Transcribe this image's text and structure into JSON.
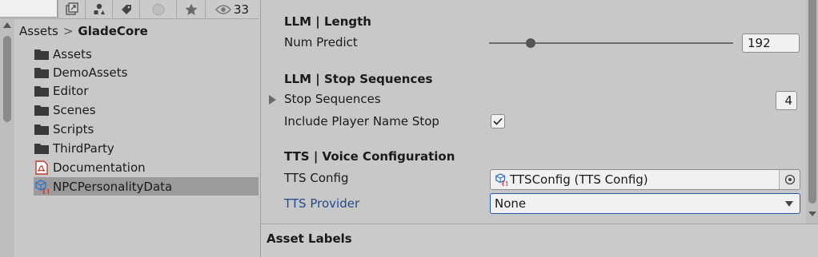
{
  "project": {
    "toolbar": {
      "hidden_count": "33"
    },
    "breadcrumb": {
      "root": "Assets",
      "separator": ">",
      "current": "GladeCore"
    },
    "items": [
      {
        "label": "Assets",
        "icon": "folder-icon"
      },
      {
        "label": "DemoAssets",
        "icon": "folder-icon"
      },
      {
        "label": "Editor",
        "icon": "folder-icon"
      },
      {
        "label": "Scenes",
        "icon": "folder-icon"
      },
      {
        "label": "Scripts",
        "icon": "folder-icon"
      },
      {
        "label": "ThirdParty",
        "icon": "folder-icon"
      },
      {
        "label": "Documentation",
        "icon": "pdf-icon"
      },
      {
        "label": "NPCPersonalityData",
        "icon": "scriptable-object-icon"
      }
    ]
  },
  "inspector": {
    "length_header": "LLM | Length",
    "num_predict_label": "Num Predict",
    "num_predict_value": "192",
    "num_predict_slider_fraction": 0.17,
    "stop_header": "LLM | Stop Sequences",
    "stop_sequences_label": "Stop Sequences",
    "stop_sequences_count": "4",
    "include_player_name_stop_label": "Include Player Name Stop",
    "include_player_name_stop_checked": true,
    "tts_header": "TTS | Voice Configuration",
    "tts_config_label": "TTS Config",
    "tts_config_value": "TTSConfig (TTS Config)",
    "tts_provider_label": "TTS Provider",
    "tts_provider_value": "None",
    "asset_labels_title": "Asset Labels"
  },
  "colors": {
    "link_label": "#244a8c",
    "focus_border": "#2b57a6",
    "selection": "#9b9b9b"
  }
}
